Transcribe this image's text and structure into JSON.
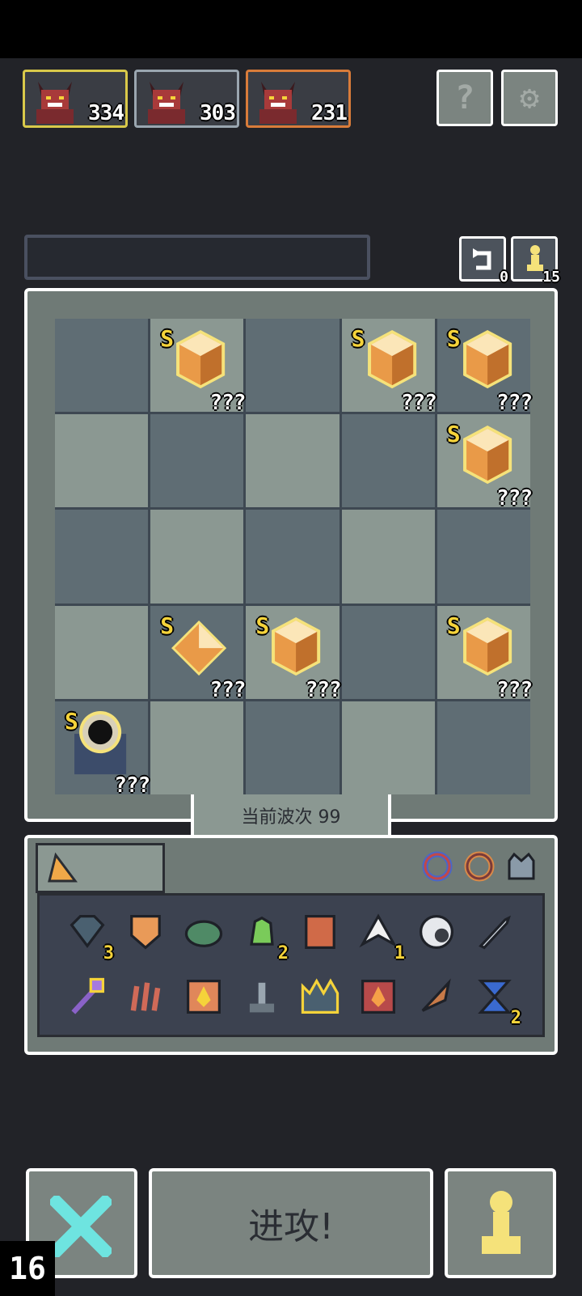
{
  "enemies": [
    {
      "hp": "334",
      "border": "#d9c94a"
    },
    {
      "hp": "303",
      "border": "#9aa6b0"
    },
    {
      "hp": "231",
      "border": "#d97c3a"
    }
  ],
  "top_buttons": {
    "help_icon": "question-icon",
    "settings_icon": "gear-icon"
  },
  "undo": {
    "count": "0"
  },
  "pawns": {
    "count": "15"
  },
  "board": {
    "rows": [
      [
        "empty",
        "crystal",
        "empty",
        "crystal",
        "crystal"
      ],
      [
        "empty",
        "empty",
        "empty",
        "empty",
        "crystal"
      ],
      [
        "empty",
        "empty",
        "empty",
        "empty",
        "empty"
      ],
      [
        "empty",
        "diamond",
        "crystal",
        "empty",
        "crystal"
      ],
      [
        "eye",
        "empty",
        "empty",
        "empty",
        "empty"
      ]
    ],
    "rank_label": "S",
    "unknown_label": "???"
  },
  "wave": {
    "label": "当前波次 99"
  },
  "inventory": {
    "tab_icon": "wedge-icon",
    "filters": [
      "blue-ring-icon",
      "orange-ring-icon",
      "helmet-icon"
    ],
    "items": [
      {
        "icon": "crystal-heart-icon",
        "count": "3"
      },
      {
        "icon": "armor-icon",
        "count": ""
      },
      {
        "icon": "turtle-shell-icon",
        "count": ""
      },
      {
        "icon": "green-hand-icon",
        "count": "2"
      },
      {
        "icon": "banner-icon",
        "count": ""
      },
      {
        "icon": "wings-icon",
        "count": "1"
      },
      {
        "icon": "orb-icon",
        "count": ""
      },
      {
        "icon": "sword-icon",
        "count": ""
      },
      {
        "icon": "staff-icon",
        "count": ""
      },
      {
        "icon": "claw-icon",
        "count": ""
      },
      {
        "icon": "fire-scroll-icon",
        "count": ""
      },
      {
        "icon": "lever-icon",
        "count": ""
      },
      {
        "icon": "spiked-crown-icon",
        "count": ""
      },
      {
        "icon": "flame-book-icon",
        "count": ""
      },
      {
        "icon": "leaf-blade-icon",
        "count": ""
      },
      {
        "icon": "hourglass-icon",
        "count": "2"
      }
    ]
  },
  "bottom": {
    "cancel_icon": "x-icon",
    "attack_label": "进攻!",
    "pawn_icon": "pawn-icon"
  },
  "turn_counter": "16"
}
